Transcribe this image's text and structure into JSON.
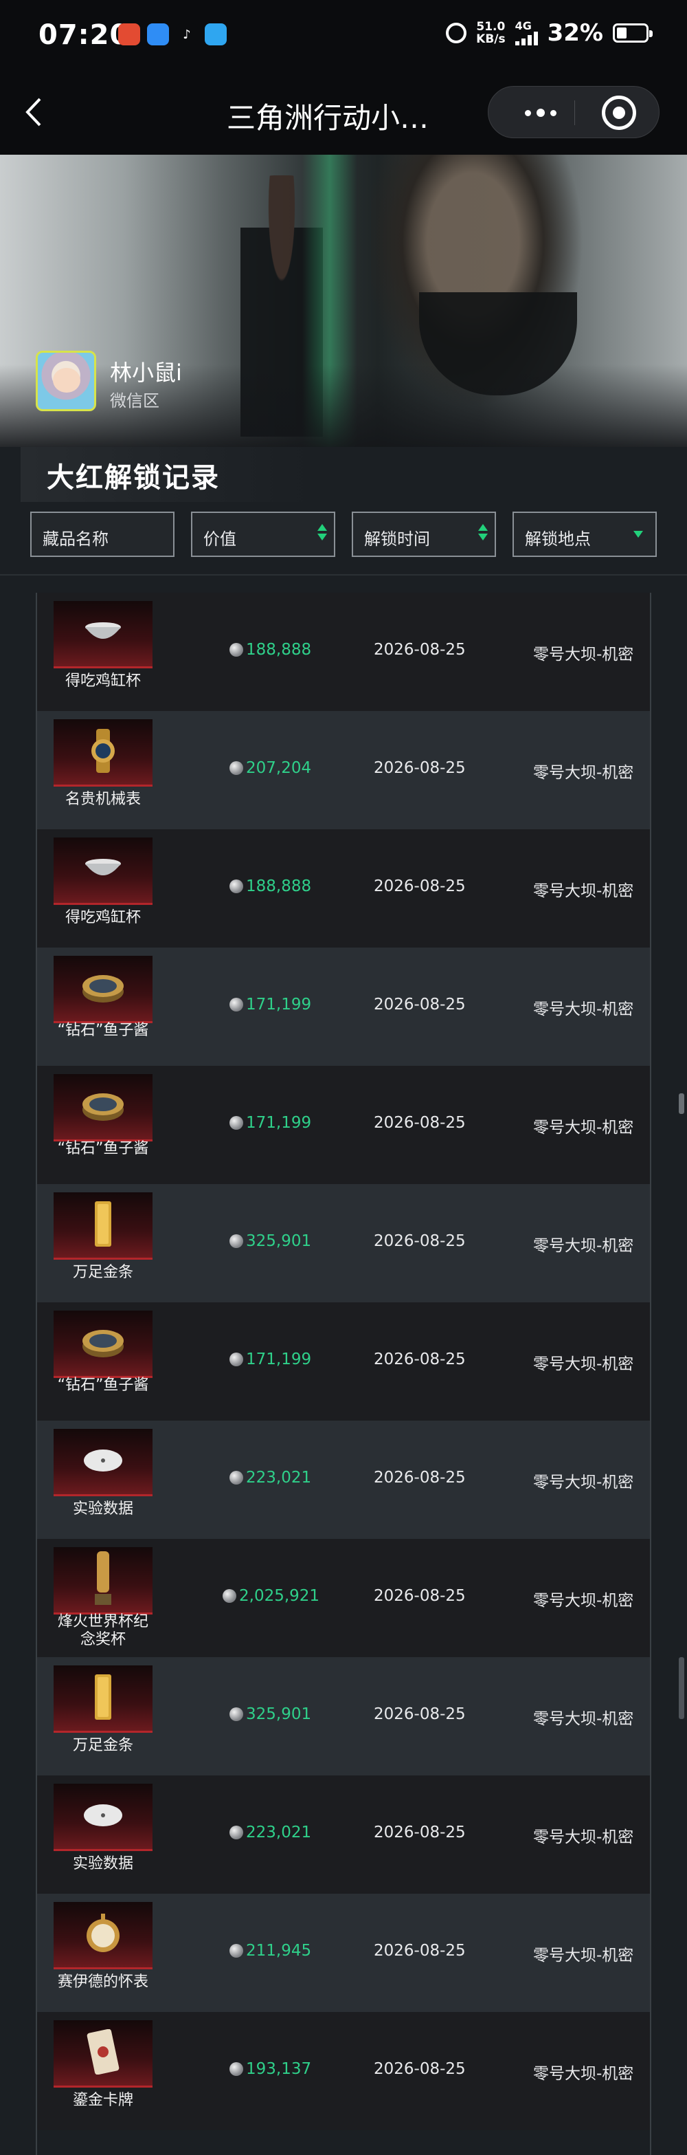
{
  "status_bar": {
    "time": "07:20",
    "net_speed_value": "51.0",
    "net_speed_unit": "KB/s",
    "network": "4G",
    "battery": "32%",
    "app_icons": [
      "app-icon-red",
      "app-icon-blue",
      "tiktok-icon",
      "app-icon-cyan"
    ]
  },
  "nav": {
    "title": "三角洲行动小…"
  },
  "profile": {
    "name": "林小鼠i",
    "region": "微信区"
  },
  "section": {
    "title": "大红解锁记录",
    "filters": [
      {
        "label": "藏品名称",
        "icon": "none"
      },
      {
        "label": "价值",
        "icon": "sort-icon"
      },
      {
        "label": "解锁时间",
        "icon": "sort-icon"
      },
      {
        "label": "解锁地点",
        "icon": "dropdown-icon"
      }
    ]
  },
  "colors": {
    "accent_green": "#2fd08a",
    "thumb_red": "#b3262b"
  },
  "records": [
    {
      "name": "得吃鸡缸杯",
      "value": "188,888",
      "date": "2026-08-25",
      "place": "零号大坝-机密",
      "icon": "bowl-icon"
    },
    {
      "name": "名贵机械表",
      "value": "207,204",
      "date": "2026-08-25",
      "place": "零号大坝-机密",
      "icon": "watch-icon"
    },
    {
      "name": "得吃鸡缸杯",
      "value": "188,888",
      "date": "2026-08-25",
      "place": "零号大坝-机密",
      "icon": "bowl-icon"
    },
    {
      "name": "“钻石”鱼子酱",
      "value": "171,199",
      "date": "2026-08-25",
      "place": "零号大坝-机密",
      "icon": "caviar-tin-icon"
    },
    {
      "name": "“钻石”鱼子酱",
      "value": "171,199",
      "date": "2026-08-25",
      "place": "零号大坝-机密",
      "icon": "caviar-tin-icon"
    },
    {
      "name": "万足金条",
      "value": "325,901",
      "date": "2026-08-25",
      "place": "零号大坝-机密",
      "icon": "gold-bar-icon"
    },
    {
      "name": "“钻石”鱼子酱",
      "value": "171,199",
      "date": "2026-08-25",
      "place": "零号大坝-机密",
      "icon": "caviar-tin-icon"
    },
    {
      "name": "实验数据",
      "value": "223,021",
      "date": "2026-08-25",
      "place": "零号大坝-机密",
      "icon": "disc-icon"
    },
    {
      "name": "烽火世界杯纪念奖杯",
      "value": "2,025,921",
      "date": "2026-08-25",
      "place": "零号大坝-机密",
      "icon": "trophy-icon"
    },
    {
      "name": "万足金条",
      "value": "325,901",
      "date": "2026-08-25",
      "place": "零号大坝-机密",
      "icon": "gold-bar-icon"
    },
    {
      "name": "实验数据",
      "value": "223,021",
      "date": "2026-08-25",
      "place": "零号大坝-机密",
      "icon": "disc-icon"
    },
    {
      "name": "赛伊德的怀表",
      "value": "211,945",
      "date": "2026-08-25",
      "place": "零号大坝-机密",
      "icon": "pocket-watch-icon"
    },
    {
      "name": "鎏金卡牌",
      "value": "193,137",
      "date": "2026-08-25",
      "place": "零号大坝-机密",
      "icon": "card-icon"
    }
  ]
}
